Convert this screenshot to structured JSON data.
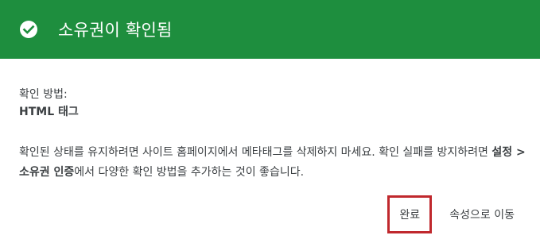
{
  "header": {
    "title": "소유권이 확인됨",
    "icon": "check-circle-icon",
    "background_color": "#1e8e3e"
  },
  "verification": {
    "method_label": "확인 방법:",
    "method_value": "HTML 태그"
  },
  "description": {
    "part1": "확인된 상태를 유지하려면 사이트 홈페이지에서 메타태그를 삭제하지 마세요. 확인 실패를 방지하려면 ",
    "bold": "설정 > 소유권 인증",
    "part2": "에서 다양한 확인 방법을 추가하는 것이 좋습니다."
  },
  "actions": {
    "done_label": "완료",
    "go_to_property_label": "속성으로 이동",
    "highlight_color": "#c0282d"
  }
}
